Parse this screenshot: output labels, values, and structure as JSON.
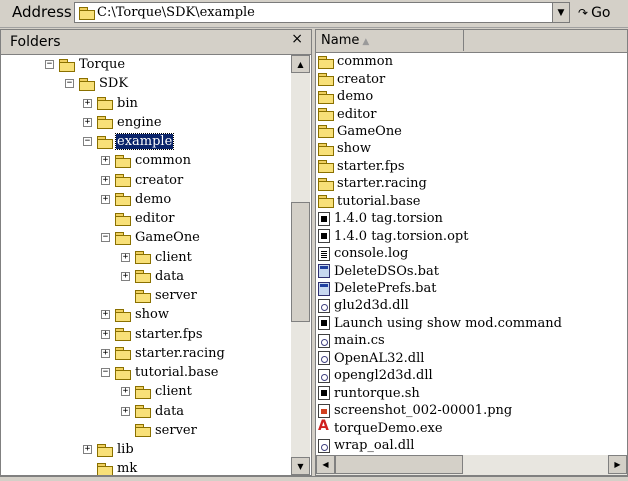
{
  "address_bar": {
    "label": "Address",
    "path": "C:\\Torque\\SDK\\example",
    "go_label": "Go"
  },
  "folders_pane": {
    "title": "Folders",
    "close_glyph": "×",
    "tree": [
      {
        "label": "Torque",
        "expander": "−",
        "icon": "folder-open-icon"
      },
      {
        "label": "SDK",
        "expander": "−",
        "icon": "folder-open-icon"
      },
      {
        "label": "bin",
        "expander": "+",
        "icon": "folder-icon"
      },
      {
        "label": "engine",
        "expander": "+",
        "icon": "folder-icon"
      },
      {
        "label": "example",
        "expander": "−",
        "icon": "folder-open-icon",
        "selected": true
      },
      {
        "label": "common",
        "expander": "+",
        "icon": "folder-icon"
      },
      {
        "label": "creator",
        "expander": "+",
        "icon": "folder-icon"
      },
      {
        "label": "demo",
        "expander": "+",
        "icon": "folder-icon"
      },
      {
        "label": "editor",
        "expander": "",
        "icon": "folder-icon"
      },
      {
        "label": "GameOne",
        "expander": "−",
        "icon": "folder-open-icon"
      },
      {
        "label": "client",
        "expander": "+",
        "icon": "folder-icon"
      },
      {
        "label": "data",
        "expander": "+",
        "icon": "folder-icon"
      },
      {
        "label": "server",
        "expander": "",
        "icon": "folder-icon"
      },
      {
        "label": "show",
        "expander": "+",
        "icon": "folder-icon"
      },
      {
        "label": "starter.fps",
        "expander": "+",
        "icon": "folder-icon"
      },
      {
        "label": "starter.racing",
        "expander": "+",
        "icon": "folder-icon"
      },
      {
        "label": "tutorial.base",
        "expander": "−",
        "icon": "folder-open-icon"
      },
      {
        "label": "client",
        "expander": "+",
        "icon": "folder-icon"
      },
      {
        "label": "data",
        "expander": "+",
        "icon": "folder-icon"
      },
      {
        "label": "server",
        "expander": "",
        "icon": "folder-icon"
      },
      {
        "label": "lib",
        "expander": "+",
        "icon": "folder-icon"
      },
      {
        "label": "mk",
        "expander": "",
        "icon": "folder-icon"
      }
    ]
  },
  "file_pane": {
    "column_name": "Name",
    "sort_glyph": "▲",
    "items": [
      {
        "label": "common",
        "type": "folder"
      },
      {
        "label": "creator",
        "type": "folder"
      },
      {
        "label": "demo",
        "type": "folder"
      },
      {
        "label": "editor",
        "type": "folder"
      },
      {
        "label": "GameOne",
        "type": "folder"
      },
      {
        "label": "show",
        "type": "folder"
      },
      {
        "label": "starter.fps",
        "type": "folder"
      },
      {
        "label": "starter.racing",
        "type": "folder"
      },
      {
        "label": "tutorial.base",
        "type": "folder"
      },
      {
        "label": "1.4.0 tag.torsion",
        "type": "doc"
      },
      {
        "label": "1.4.0 tag.torsion.opt",
        "type": "doc"
      },
      {
        "label": "console.log",
        "type": "log"
      },
      {
        "label": "DeleteDSOs.bat",
        "type": "bat"
      },
      {
        "label": "DeletePrefs.bat",
        "type": "bat"
      },
      {
        "label": "glu2d3d.dll",
        "type": "dll"
      },
      {
        "label": "Launch using show mod.command",
        "type": "doc"
      },
      {
        "label": "main.cs",
        "type": "dll"
      },
      {
        "label": "OpenAL32.dll",
        "type": "dll"
      },
      {
        "label": "opengl2d3d.dll",
        "type": "dll"
      },
      {
        "label": "runtorque.sh",
        "type": "doc"
      },
      {
        "label": "screenshot_002-00001.png",
        "type": "png"
      },
      {
        "label": "torqueDemo.exe",
        "type": "exe"
      },
      {
        "label": "wrap_oal.dll",
        "type": "dll"
      }
    ]
  },
  "colors": {
    "selection": "#0a246a",
    "chrome": "#d4d0c8",
    "folder_yellow": "#f8e078"
  }
}
